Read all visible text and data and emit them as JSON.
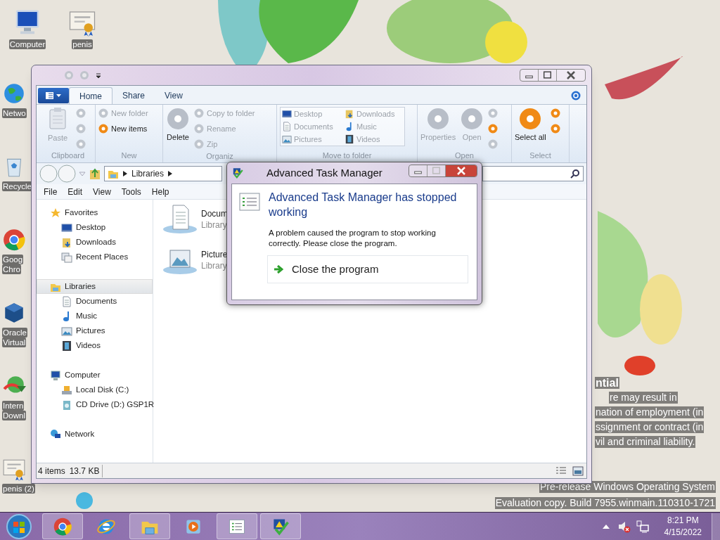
{
  "desktop": {
    "columns": [
      [
        {
          "kind": "computer",
          "lines": [
            "Computer"
          ]
        },
        {
          "kind": "network",
          "lines": [
            "Netwo"
          ]
        },
        {
          "kind": "recycle-bin",
          "lines": [
            "Recycle"
          ]
        },
        {
          "kind": "chrome",
          "lines": [
            "Goog",
            "Chro"
          ]
        },
        {
          "kind": "virtualbox",
          "lines": [
            "Oracle",
            "Virtual"
          ]
        },
        {
          "kind": "download-manager",
          "lines": [
            "Intern",
            "Downl"
          ]
        },
        {
          "kind": "certificate",
          "lines": [
            "penis (2)"
          ]
        }
      ],
      [
        {
          "kind": "certificate",
          "lines": [
            "penis"
          ]
        }
      ]
    ],
    "wallpaper_text": [
      "ntial",
      "re may result in",
      "nation of employment (in",
      "ssignment or contract (in",
      "vil and criminal liability.",
      "Pre-release Windows Operating System",
      "Evaluation copy. Build 7955.winmain.110310-1721"
    ]
  },
  "explorer": {
    "ribbon": {
      "tabs": [
        {
          "label": "Home",
          "selected": true
        },
        {
          "label": "Share",
          "selected": false
        },
        {
          "label": "View",
          "selected": false
        }
      ],
      "groups": [
        {
          "label": "Clipboard",
          "commands": [
            {
              "kind": "paste",
              "label": "Paste",
              "enabled": false
            },
            {
              "kind": "dots",
              "dots": [
                false,
                false,
                false
              ]
            }
          ]
        },
        {
          "label": "New",
          "commands": [
            {
              "kind": "smalls",
              "items": [
                {
                  "label": "New folder",
                  "enabled": false,
                  "highlighted": false
                },
                {
                  "label": "New items",
                  "enabled": true,
                  "highlighted": true
                }
              ]
            }
          ]
        },
        {
          "label": "Organiz",
          "commands": [
            {
              "kind": "large",
              "label": "Delete",
              "enabled": true,
              "highlighted": false
            },
            {
              "kind": "smalls",
              "items": [
                {
                  "label": "Copy to folder",
                  "enabled": false,
                  "highlighted": false
                },
                {
                  "label": "Rename",
                  "enabled": false,
                  "highlighted": false
                },
                {
                  "label": "Zip",
                  "enabled": false,
                  "highlighted": false
                }
              ]
            }
          ]
        },
        {
          "label": "Move to folder",
          "commands": [
            {
              "kind": "gallery",
              "items": [
                {
                  "kind": "desktop",
                  "label": "Desktop"
                },
                {
                  "kind": "downloads",
                  "label": "Downloads"
                },
                {
                  "kind": "documents",
                  "label": "Documents"
                },
                {
                  "kind": "music",
                  "label": "Music"
                },
                {
                  "kind": "pictures",
                  "label": "Pictures"
                },
                {
                  "kind": "videos",
                  "label": "Videos"
                }
              ]
            }
          ]
        },
        {
          "label": "Open",
          "commands": [
            {
              "kind": "large",
              "label": "Properties",
              "enabled": false,
              "highlighted": false
            },
            {
              "kind": "large",
              "label": "Open",
              "enabled": false,
              "highlighted": false
            },
            {
              "kind": "dots",
              "dots": [
                false,
                true,
                false
              ]
            }
          ]
        },
        {
          "label": "Select",
          "commands": [
            {
              "kind": "large",
              "label": "Select all",
              "enabled": true,
              "highlighted": true
            },
            {
              "kind": "dots",
              "dots": [
                true,
                true
              ]
            }
          ]
        }
      ]
    },
    "address": {
      "crumbs": [
        "Libraries"
      ]
    },
    "menu": [
      "File",
      "Edit",
      "View",
      "Tools",
      "Help"
    ],
    "nav": [
      {
        "kind": "favorites",
        "label": "Favorites",
        "selected": false,
        "children": [
          {
            "kind": "desktop",
            "label": "Desktop",
            "selected": false
          },
          {
            "kind": "downloads",
            "label": "Downloads",
            "selected": false
          },
          {
            "kind": "recent",
            "label": "Recent Places",
            "selected": false
          }
        ]
      },
      {
        "kind": "libraries",
        "label": "Libraries",
        "selected": true,
        "children": [
          {
            "kind": "documents",
            "label": "Documents",
            "selected": false
          },
          {
            "kind": "music",
            "label": "Music",
            "selected": false
          },
          {
            "kind": "pictures",
            "label": "Pictures",
            "selected": false
          },
          {
            "kind": "videos",
            "label": "Videos",
            "selected": false
          }
        ]
      },
      {
        "kind": "computer",
        "label": "Computer",
        "selected": false,
        "children": [
          {
            "kind": "disk",
            "label": "Local Disk (C:)",
            "selected": false
          },
          {
            "kind": "cd",
            "label": "CD Drive (D:) GSP1R",
            "selected": false
          }
        ]
      },
      {
        "kind": "network",
        "label": "Network",
        "selected": false
      }
    ],
    "items": [
      {
        "kind": "documents",
        "name": "Docum",
        "type": "Library"
      },
      {
        "kind": "pictures",
        "name": "Picture",
        "type": "Library"
      }
    ],
    "status": [
      "4 items",
      "13.7 KB"
    ]
  },
  "dialog": {
    "title": "Advanced Task Manager",
    "heading": "Advanced Task Manager has stopped working",
    "body": "A problem caused the program to stop working correctly. Please close the program.",
    "action": "Close the program"
  },
  "taskbar": {
    "apps": [
      {
        "kind": "chrome",
        "running": true
      },
      {
        "kind": "ie",
        "running": false
      },
      {
        "kind": "explorer",
        "running": true
      },
      {
        "kind": "media-player",
        "running": false
      },
      {
        "kind": "task-list",
        "running": true
      },
      {
        "kind": "warning-check",
        "running": true
      }
    ],
    "time": "8:21 PM",
    "date": "4/15/2022"
  }
}
